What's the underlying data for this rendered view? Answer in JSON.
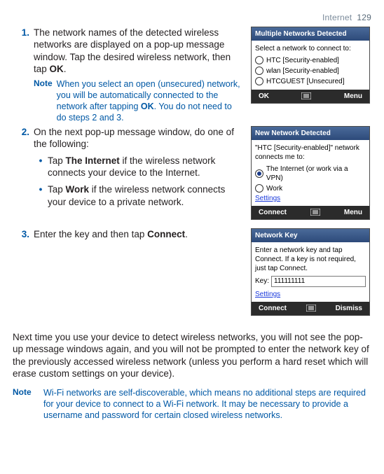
{
  "header": {
    "section": "Internet",
    "page": "129"
  },
  "step1": {
    "num": "1.",
    "text_a": "The network names of the detected wireless networks are displayed on a pop-up message window. Tap the desired wireless network, then tap ",
    "text_b": "OK",
    "text_c": ".",
    "note_label": "Note",
    "note_a": "When you select an open (unsecured) network, you will be automatically connected to the network after tapping ",
    "note_b": "OK",
    "note_c": ". You do not need to do steps 2 and 3."
  },
  "step2": {
    "num": "2.",
    "text": "On the next pop-up message window, do one of the following:",
    "bullet1_a": "Tap ",
    "bullet1_b": "The Internet",
    "bullet1_c": " if the wireless network connects your device to the Internet.",
    "bullet2_a": "Tap ",
    "bullet2_b": "Work",
    "bullet2_c": " if the wireless network connects your device to a private network."
  },
  "step3": {
    "num": "3.",
    "text_a": "Enter the key and then tap ",
    "text_b": "Connect",
    "text_c": "."
  },
  "shot1": {
    "title": "Multiple Networks Detected",
    "prompt": "Select a network to connect to:",
    "opt1": "HTC [Security-enabled]",
    "opt2": "wlan [Security-enabled]",
    "opt3": "HTCGUEST [Unsecured]",
    "left": "OK",
    "right": "Menu"
  },
  "shot2": {
    "title": "New Network Detected",
    "prompt": "\"HTC [Security-enabled]\" network connects me to:",
    "opt1": "The Internet (or work via a VPN)",
    "opt2": "Work",
    "link": "Settings",
    "left": "Connect",
    "right": "Menu"
  },
  "shot3": {
    "title": "Network Key",
    "prompt": "Enter a network key and tap Connect. If a key is not required, just tap Connect.",
    "key_label": "Key:",
    "key_value": "111111111",
    "link": "Settings",
    "left": "Connect",
    "right": "Dismiss"
  },
  "para": "Next time you use your device to detect wireless networks, you will not see the pop-up message windows again, and you will not be prompted to enter the network key of the previously accessed wireless network (unless you perform a hard reset which will erase custom settings on your device).",
  "final_note": {
    "label": "Note",
    "text": "Wi-Fi networks are self-discoverable, which means no additional steps are required for your device to connect to a Wi-Fi network. It may be necessary to provide a username and password for certain closed wireless networks."
  }
}
